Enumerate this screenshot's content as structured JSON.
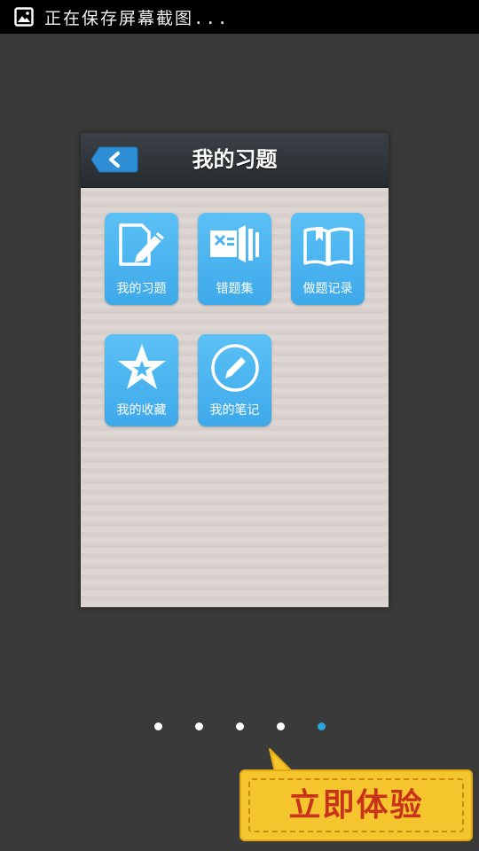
{
  "status_bar": {
    "text": "正在保存屏幕截图...",
    "icon": "image-icon"
  },
  "preview": {
    "title": "我的习题",
    "back_icon": "chevron-left-icon",
    "tiles": [
      {
        "label": "我的习题",
        "icon": "edit-document-icon"
      },
      {
        "label": "错题集",
        "icon": "wrong-answers-icon"
      },
      {
        "label": "做题记录",
        "icon": "open-book-icon"
      },
      {
        "label": "我的收藏",
        "icon": "star-icon"
      },
      {
        "label": "我的笔记",
        "icon": "pencil-circle-icon"
      }
    ]
  },
  "pager": {
    "total": 5,
    "active_index": 4,
    "active_color": "#2aa5e0"
  },
  "cta": {
    "label": "立即体验"
  },
  "colors": {
    "tile_blue": "#4cb4ef",
    "cta_yellow": "#f4c52d",
    "cta_text": "#c9331c",
    "background": "#3a3a3a"
  }
}
